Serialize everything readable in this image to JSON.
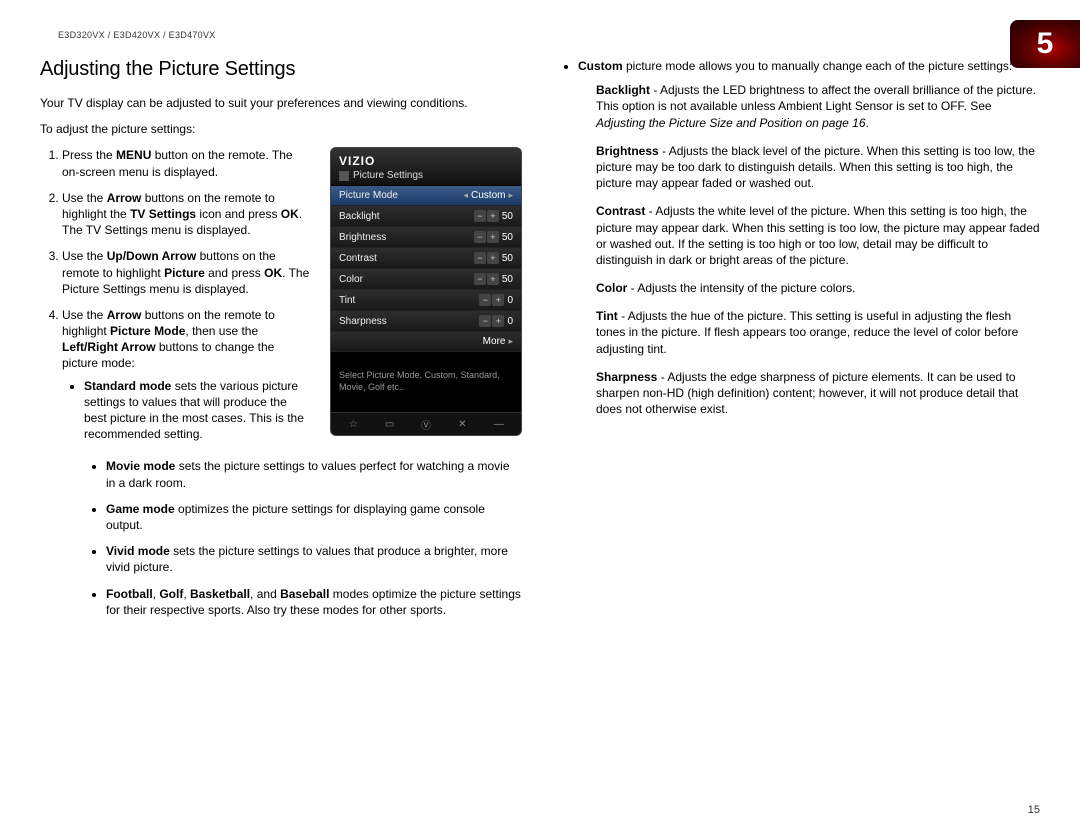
{
  "header": {
    "model": "E3D320VX / E3D420VX / E3D470VX"
  },
  "chapter": {
    "number": "5"
  },
  "left": {
    "title": "Adjusting the Picture Settings",
    "intro": "Your TV display can be adjusted to suit your preferences and viewing conditions.",
    "lead": "To adjust the picture settings:",
    "steps": {
      "s1a": "Press the ",
      "s1_menu": "MENU",
      "s1b": " button on the remote. The on-screen menu is displayed.",
      "s2a": "Use the ",
      "s2_arrow": "Arrow",
      "s2b": " buttons on the remote to highlight the ",
      "s2_tv": "TV Settings",
      "s2c": " icon and press ",
      "s2_ok": "OK",
      "s2d": ". The TV Settings menu is displayed.",
      "s3a": "Use the ",
      "s3_ud": "Up/Down Arrow",
      "s3b": " buttons on the remote to highlight ",
      "s3_pic": "Picture",
      "s3c": " and press ",
      "s3_ok": "OK",
      "s3d": ". The Picture Settings menu is displayed.",
      "s4a": "Use the ",
      "s4_arrow": "Arrow",
      "s4b": " buttons on the remote to highlight ",
      "s4_pm": "Picture Mode",
      "s4c": ", then use the ",
      "s4_lr": "Left/Right Arrow",
      "s4d": " buttons to change the picture mode:"
    },
    "modes": {
      "std_b": "Standard mode",
      "std_t": " sets the various picture settings to values that will produce the best picture in the most cases. This is the recommended setting.",
      "mov_b": "Movie mode",
      "mov_t": " sets the picture settings to values perfect for watching a movie in a dark room.",
      "game_b": "Game mode",
      "game_t": " optimizes the picture settings for displaying game console output.",
      "viv_b": "Vivid mode",
      "viv_t": " sets the picture settings to values that produce a brighter, more vivid picture.",
      "sport_b1": "Football",
      "sport_c1": ", ",
      "sport_b2": "Golf",
      "sport_c2": ", ",
      "sport_b3": "Basketball",
      "sport_c3": ", and ",
      "sport_b4": "Baseball",
      "sport_t": " modes optimize the picture settings for their respective sports. Also try these modes for other sports."
    }
  },
  "osd": {
    "logo": "VIZIO",
    "subtitle": "Picture Settings",
    "rows": {
      "pm_label": "Picture Mode",
      "pm_value": "Custom",
      "bl_label": "Backlight",
      "bl_value": "50",
      "br_label": "Brightness",
      "br_value": "50",
      "ct_label": "Contrast",
      "ct_value": "50",
      "co_label": "Color",
      "co_value": "50",
      "ti_label": "Tint",
      "ti_value": "0",
      "sh_label": "Sharpness",
      "sh_value": "0",
      "more_label": "More"
    },
    "hint": "Select Picture Mode. Custom, Standard, Movie, Golf etc.."
  },
  "right": {
    "custom_b": "Custom",
    "custom_t": " picture mode allows you to manually change each of the picture settings:",
    "defs": {
      "bl_b": "Backlight",
      "bl_t1": " - Adjusts the LED brightness to affect the overall brilliance of the picture. This option is not available unless Ambient Light Sensor is set to OFF. See ",
      "bl_ref": "Adjusting the Picture Size and Position on page 16",
      "bl_t2": ".",
      "br_b": "Brightness",
      "br_t": " - Adjusts the black level of the picture. When this setting is too low, the picture may be too dark to distinguish details. When this setting is too high, the picture may appear faded or washed out.",
      "ct_b": "Contrast",
      "ct_t": " - Adjusts the white level of the picture. When this setting is too high, the picture may appear dark. When this setting is too low, the picture may appear faded or washed out. If the setting is too high or too low, detail may be difficult to distinguish in dark or bright areas of the picture.",
      "co_b": "Color",
      "co_t": " - Adjusts the intensity of the picture colors.",
      "ti_b": "Tint",
      "ti_t": " - Adjusts the hue of the picture. This setting is useful in adjusting the flesh tones in the picture. If flesh appears too orange, reduce the level of color before adjusting tint.",
      "sh_b": "Sharpness",
      "sh_t": " - Adjusts the edge sharpness of picture elements. It can be used to sharpen non-HD (high definition) content; however, it will not produce detail that does not otherwise exist."
    }
  },
  "page": {
    "number": "15"
  }
}
